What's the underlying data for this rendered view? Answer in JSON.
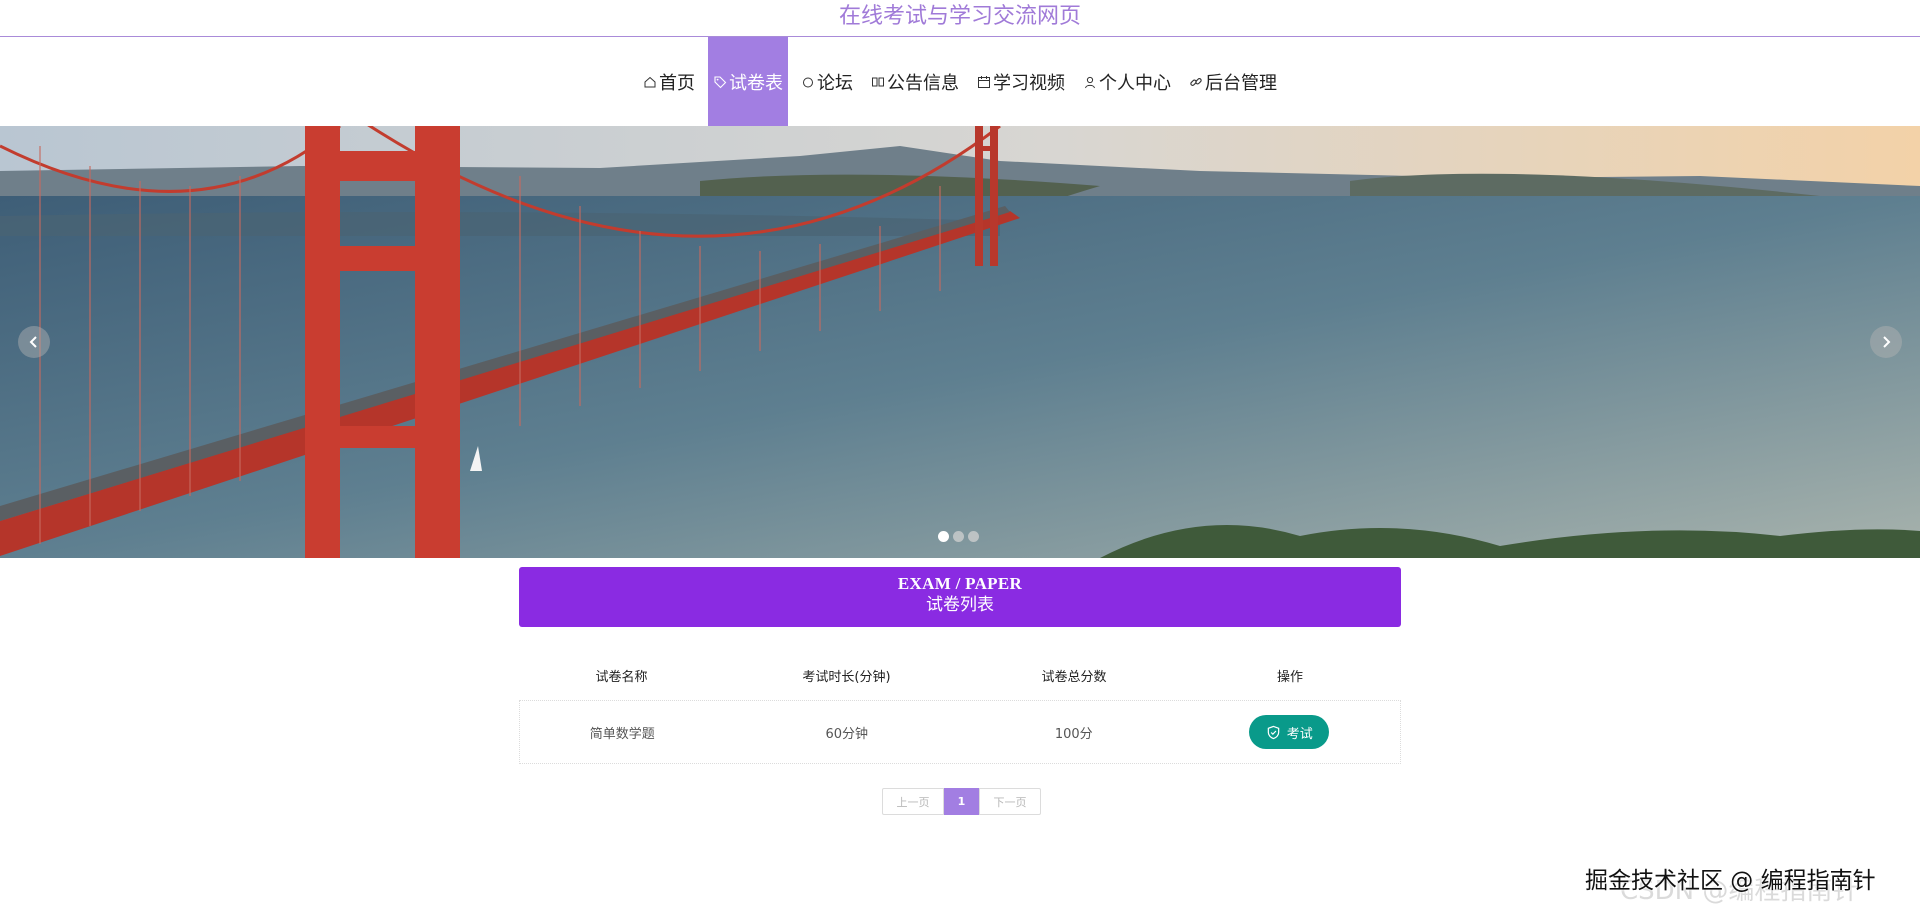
{
  "site": {
    "title": "在线考试与学习交流网页"
  },
  "nav": {
    "items": [
      {
        "label": "首页",
        "icon": "home-icon"
      },
      {
        "label": "试卷表",
        "icon": "tag-icon",
        "active": true
      },
      {
        "label": "论坛",
        "icon": "circle-icon"
      },
      {
        "label": "公告信息",
        "icon": "book-icon"
      },
      {
        "label": "学习视频",
        "icon": "calendar-icon"
      },
      {
        "label": "个人中心",
        "icon": "user-icon"
      },
      {
        "label": "后台管理",
        "icon": "link-icon"
      }
    ]
  },
  "banner": {
    "slides": 3,
    "active_slide": 1
  },
  "section": {
    "title_en": "EXAM / PAPER",
    "title_cn": "试卷列表"
  },
  "table": {
    "headers": [
      "试卷名称",
      "考试时长(分钟)",
      "试卷总分数",
      "操作"
    ],
    "rows": [
      {
        "name": "简单数学题",
        "duration": "60分钟",
        "score": "100分",
        "action": "考试"
      }
    ]
  },
  "pagination": {
    "prev": "上一页",
    "current": "1",
    "next": "下一页"
  },
  "watermark": {
    "text": "掘金技术社区 @ 编程指南针",
    "ghost": "CSDN @编程指南针"
  },
  "colors": {
    "accent": "#a27ee2",
    "section_bg": "#8a2be2",
    "button": "#099a8a"
  }
}
